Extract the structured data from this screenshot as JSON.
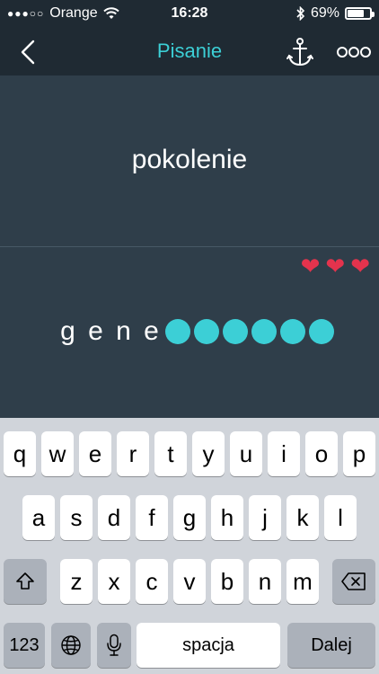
{
  "status_bar": {
    "signal": "●●●○○",
    "carrier": "Orange",
    "time": "16:28",
    "battery": "69%",
    "battery_level": 0.69
  },
  "nav": {
    "title": "Pisanie",
    "accent_color": "#3ccfd6",
    "back_icon": "chevron-left-icon",
    "anchor_icon": "anchor-icon",
    "more_icon": "more-dots-icon"
  },
  "prompt": {
    "word": "pokolenie"
  },
  "answer": {
    "lives": [
      "❤",
      "❤",
      "❤"
    ],
    "typed": [
      "g",
      "e",
      "n",
      "e"
    ],
    "blanks_remaining": 6,
    "blank_color": "#3ccfd6",
    "heart_color": "#e4334d"
  },
  "keyboard": {
    "row1": [
      "q",
      "w",
      "e",
      "r",
      "t",
      "y",
      "u",
      "i",
      "o",
      "p"
    ],
    "row2": [
      "a",
      "s",
      "d",
      "f",
      "g",
      "h",
      "j",
      "k",
      "l"
    ],
    "row3": [
      "z",
      "x",
      "c",
      "v",
      "b",
      "n",
      "m"
    ],
    "numbers_label": "123",
    "space_label": "spacja",
    "return_label": "Dalej",
    "shift_icon": "shift-icon",
    "delete_icon": "backspace-icon",
    "globe_icon": "globe-icon",
    "mic_icon": "microphone-icon"
  }
}
